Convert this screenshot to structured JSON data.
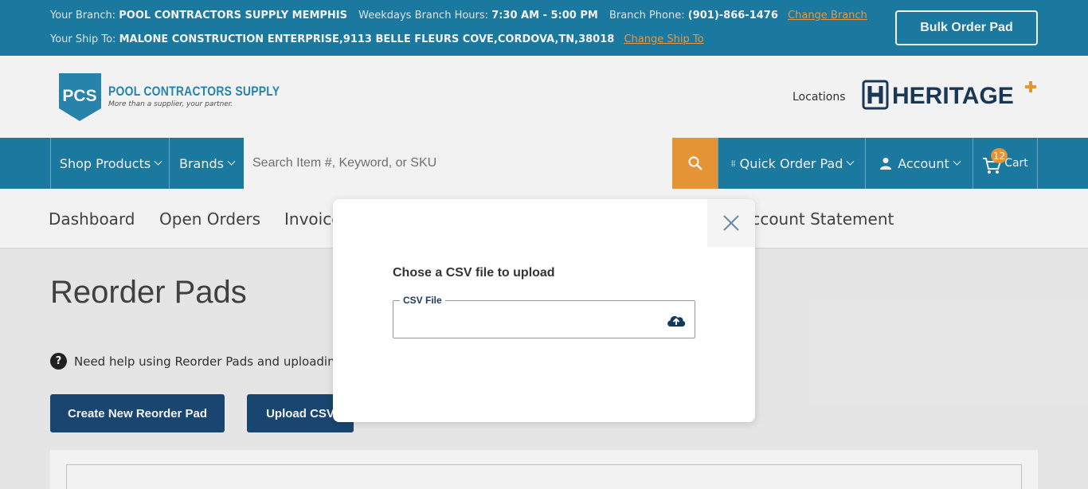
{
  "topbar": {
    "branch_label": "Your Branch:",
    "branch_value": "POOL CONTRACTORS SUPPLY MEMPHIS",
    "hours_label": "Weekdays Branch Hours:",
    "hours_value": "7:30 AM - 5:00 PM",
    "phone_label": "Branch Phone:",
    "phone_value": "(901)-866-1476",
    "change_branch": "Change Branch",
    "shipto_label": "Your Ship To:",
    "shipto_value": "MALONE CONSTRUCTION ENTERPRISE,9113 BELLE FLEURS COVE,CORDOVA,TN,38018",
    "change_shipto": "Change Ship To",
    "bulk_order": "Bulk Order Pad"
  },
  "header": {
    "logo_abbr": "PCS",
    "logo_name": "POOL CONTRACTORS SUPPLY",
    "logo_tagline": "More than a supplier, your partner.",
    "locations": "Locations",
    "heritage": "HERITAGE"
  },
  "navbar": {
    "shop_products": "Shop Products",
    "brands": "Brands",
    "search_placeholder": "Search Item #, Keyword, or SKU",
    "quick_order": "Quick Order Pad",
    "account": "Account",
    "cart": "Cart",
    "cart_count": "12"
  },
  "subnav": {
    "items": [
      "Dashboard",
      "Open Orders",
      "Invoices",
      "Account Statement"
    ]
  },
  "page": {
    "title": "Reorder Pads",
    "help_text": "Need help using Reorder Pads and uploading",
    "create_button": "Create New Reorder Pad",
    "upload_button": "Upload CSV"
  },
  "modal": {
    "title": "Chose a CSV file to upload",
    "field_label": "CSV File"
  },
  "colors": {
    "brand_blue": "#1d7fa7",
    "accent_orange": "#f29c38",
    "dark_button": "#1b4a77"
  }
}
